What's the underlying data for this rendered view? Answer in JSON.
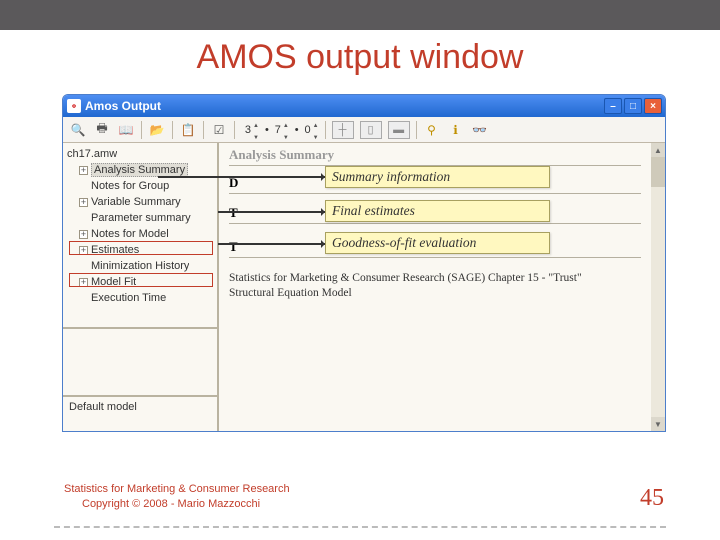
{
  "slide": {
    "title": "AMOS output window",
    "page_number": "45",
    "footer_line1": "Statistics for Marketing & Consumer Research",
    "footer_line2": "Copyright © 2008 - Mario Mazzocchi"
  },
  "window": {
    "title": "Amos Output",
    "min_tooltip": "Minimize",
    "max_tooltip": "Maximize",
    "close_tooltip": "Close",
    "toolbar": {
      "spin1": "3",
      "spin2": "7",
      "spin3": "0"
    }
  },
  "tree": {
    "root": "ch17.amw",
    "items": [
      "Analysis Summary",
      "Notes for Group",
      "Variable Summary",
      "Parameter summary",
      "Notes for Model",
      "Estimates",
      "Minimization History",
      "Model Fit",
      "Execution Time"
    ],
    "bottom_label": "Default model"
  },
  "content": {
    "heading_grey": "Analysis Summary",
    "date_prefix": "D",
    "body_line1": "Statistics for Marketing & Consumer Research (SAGE) Chapter 15 - \"Trust\"",
    "body_line2": "Structural Equation Model"
  },
  "callouts": {
    "summary": "Summary information",
    "estimates": "Final estimates",
    "fit": "Goodness-of-fit evaluation"
  }
}
